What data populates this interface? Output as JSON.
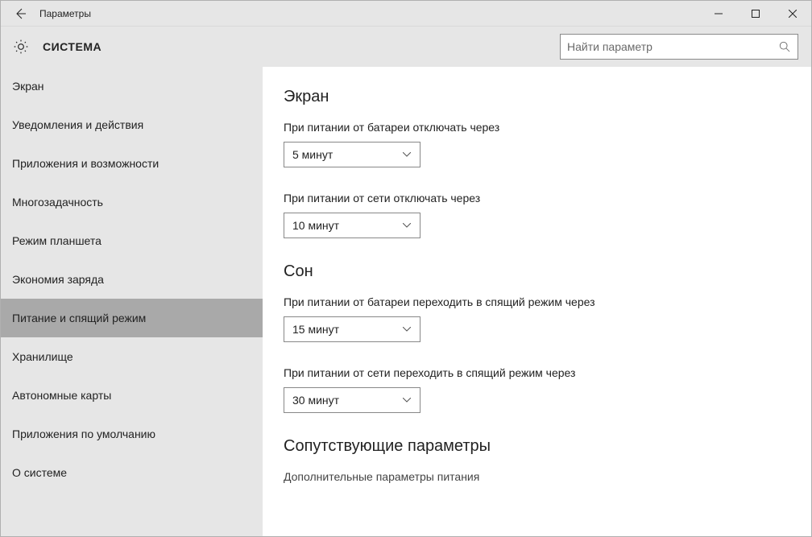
{
  "titlebar": {
    "title": "Параметры"
  },
  "header": {
    "title": "СИСТЕМА",
    "search_placeholder": "Найти параметр"
  },
  "sidebar": {
    "items": [
      {
        "label": "Экран"
      },
      {
        "label": "Уведомления и действия"
      },
      {
        "label": "Приложения и возможности"
      },
      {
        "label": "Многозадачность"
      },
      {
        "label": "Режим планшета"
      },
      {
        "label": "Экономия заряда"
      },
      {
        "label": "Питание и спящий режим"
      },
      {
        "label": "Хранилище"
      },
      {
        "label": "Автономные карты"
      },
      {
        "label": "Приложения по умолчанию"
      },
      {
        "label": "О системе"
      }
    ],
    "selected_index": 6
  },
  "content": {
    "screen_heading": "Экран",
    "battery_off_label": "При питании от батареи отключать через",
    "battery_off_value": "5 минут",
    "plugged_off_label": "При питании от сети отключать через",
    "plugged_off_value": "10 минут",
    "sleep_heading": "Сон",
    "battery_sleep_label": "При питании от батареи переходить в спящий режим через",
    "battery_sleep_value": "15 минут",
    "plugged_sleep_label": "При питании от сети переходить в спящий режим через",
    "plugged_sleep_value": "30 минут",
    "related_heading": "Сопутствующие параметры",
    "related_link": "Дополнительные параметры питания"
  }
}
